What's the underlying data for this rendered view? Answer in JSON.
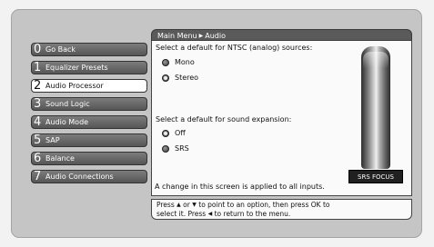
{
  "breadcrumb": {
    "root": "Main Menu",
    "current": "Audio"
  },
  "menu": {
    "items": [
      {
        "number": "0",
        "label": "Go Back",
        "selected": false
      },
      {
        "number": "1",
        "label": "Equalizer Presets",
        "selected": false
      },
      {
        "number": "2",
        "label": "Audio Processor",
        "selected": true
      },
      {
        "number": "3",
        "label": "Sound Logic",
        "selected": false
      },
      {
        "number": "4",
        "label": "Audio Mode",
        "selected": false
      },
      {
        "number": "5",
        "label": "SAP",
        "selected": false
      },
      {
        "number": "6",
        "label": "Balance",
        "selected": false
      },
      {
        "number": "7",
        "label": "Audio Connections",
        "selected": false
      }
    ]
  },
  "content": {
    "ntsc_prompt": "Select a default for NTSC (analog) sources:",
    "ntsc_options": [
      {
        "label": "Mono",
        "checked": false
      },
      {
        "label": "Stereo",
        "checked": true
      }
    ],
    "expansion_prompt": "Select a default for sound expansion:",
    "expansion_options": [
      {
        "label": "Off",
        "checked": true
      },
      {
        "label": "SRS",
        "checked": false
      }
    ],
    "footer_note": "A change in this screen is applied to all inputs.",
    "srs_label": "SRS FOCUS"
  },
  "hint": {
    "line1_press": "Press",
    "line1_or": "or",
    "line1_rest": "to point to an option, then press OK to",
    "line2_start": "select it. Press",
    "line2_end": "to return to the menu.",
    "up_arrow": "▲",
    "down_arrow": "▼",
    "left_arrow": "◀"
  },
  "colors": {
    "screen_bg": "#c5c5c5",
    "panel_bg": "#fafafa",
    "menu_button": "#656565",
    "menu_selected": "#ffffff",
    "header_bg": "#5a5a5a"
  }
}
